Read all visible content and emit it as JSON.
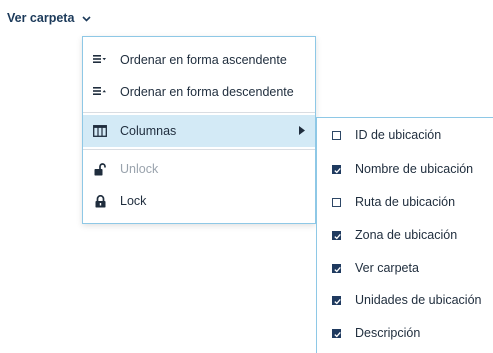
{
  "header": {
    "button_label": "Ver carpeta",
    "chevron_icon": "chevron-down-icon"
  },
  "menu": {
    "items": [
      {
        "label": "Ordenar en forma ascendente",
        "icon": "sort-ascending-icon",
        "disabled": false
      },
      {
        "label": "Ordenar en forma descendente",
        "icon": "sort-descending-icon",
        "disabled": false
      },
      {
        "label": "Columnas",
        "icon": "columns-icon",
        "disabled": false,
        "has_submenu": true,
        "active": true
      },
      {
        "label": "Unlock",
        "icon": "unlock-icon",
        "disabled": true
      },
      {
        "label": "Lock",
        "icon": "lock-icon",
        "disabled": false
      }
    ]
  },
  "submenu": {
    "items": [
      {
        "label": "ID de ubicación",
        "checked": false
      },
      {
        "label": "Nombre de ubicación",
        "checked": true
      },
      {
        "label": "Ruta de ubicación",
        "checked": false
      },
      {
        "label": "Zona de ubicación",
        "checked": true
      },
      {
        "label": "Ver carpeta",
        "checked": true
      },
      {
        "label": "Unidades de ubicación",
        "checked": true
      },
      {
        "label": "Descripción",
        "checked": true
      }
    ]
  },
  "colors": {
    "accent_border": "#8ec8e6",
    "active_bg": "#d3eaf6",
    "checkbox_fill": "#1f3a5f",
    "header_text": "#1c3a5a"
  }
}
